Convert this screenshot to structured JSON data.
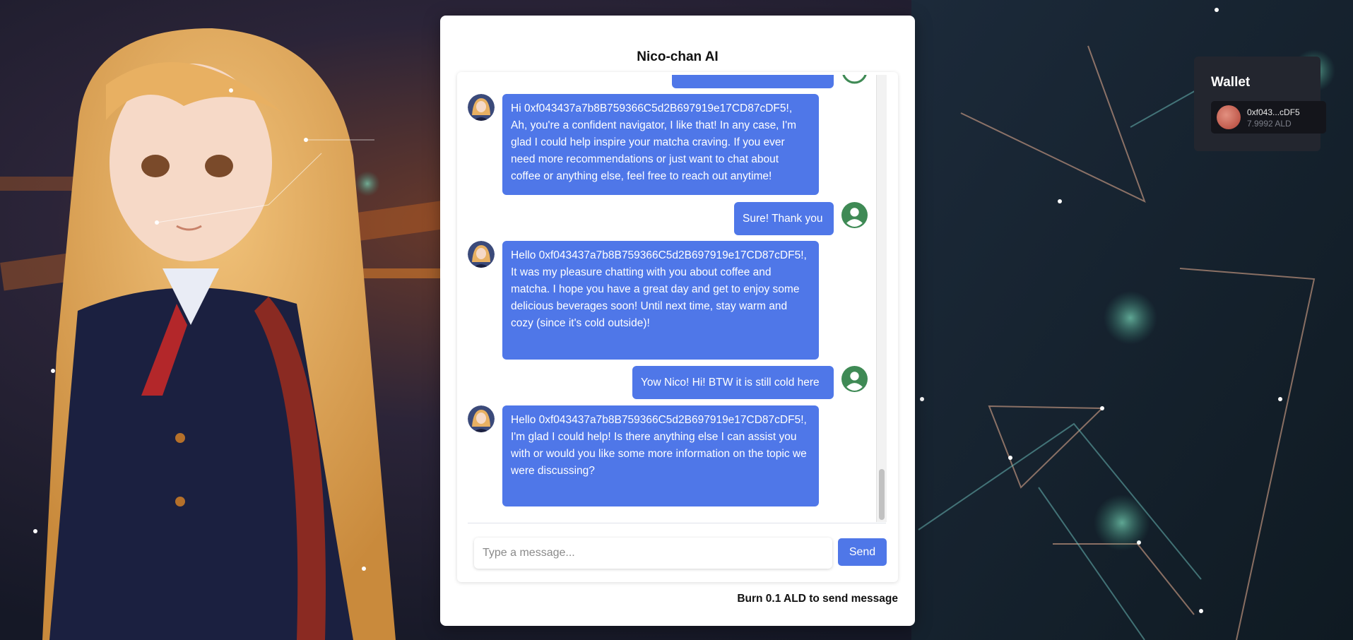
{
  "app": {
    "title": "Nico-chan AI"
  },
  "chat": {
    "messages": [
      {
        "role": "user",
        "text": ""
      },
      {
        "role": "bot",
        "text": "Hi 0xf043437a7b8B759366C5d2B697919e17CD87cDF5!, Ah, you're a confident navigator, I like that! In any case, I'm glad I could help inspire your matcha craving. If you ever need more recommendations or just want to chat about coffee or anything else, feel free to reach out anytime!"
      },
      {
        "role": "user",
        "text": "Sure! Thank you"
      },
      {
        "role": "bot",
        "text": "Hello 0xf043437a7b8B759366C5d2B697919e17CD87cDF5!, It was my pleasure chatting with you about coffee and matcha. I hope you have a great day and get to enjoy some delicious beverages soon! Until next time, stay warm and cozy (since it's cold outside)!"
      },
      {
        "role": "user",
        "text": "Yow Nico! Hi! BTW it is still cold here"
      },
      {
        "role": "bot",
        "text": "Hello 0xf043437a7b8B759366C5d2B697919e17CD87cDF5!, I'm glad I could help! Is there anything else I can assist you with or would you like some more information on the topic we were discussing?"
      }
    ]
  },
  "composer": {
    "placeholder": "Type a message...",
    "value": "",
    "send_label": "Send"
  },
  "footer": {
    "burn_note": "Burn 0.1 ALD to send message"
  },
  "wallet": {
    "title": "Wallet",
    "address_short": "0xf043...cDF5",
    "balance": "7.9992 ALD"
  },
  "colors": {
    "accent": "#4f77e8",
    "user_avatar": "#3f8a55",
    "wallet_panel": "#23262f"
  },
  "icons": {
    "user_avatar": "user-circle-icon",
    "bot_avatar": "nico-avatar-icon"
  }
}
